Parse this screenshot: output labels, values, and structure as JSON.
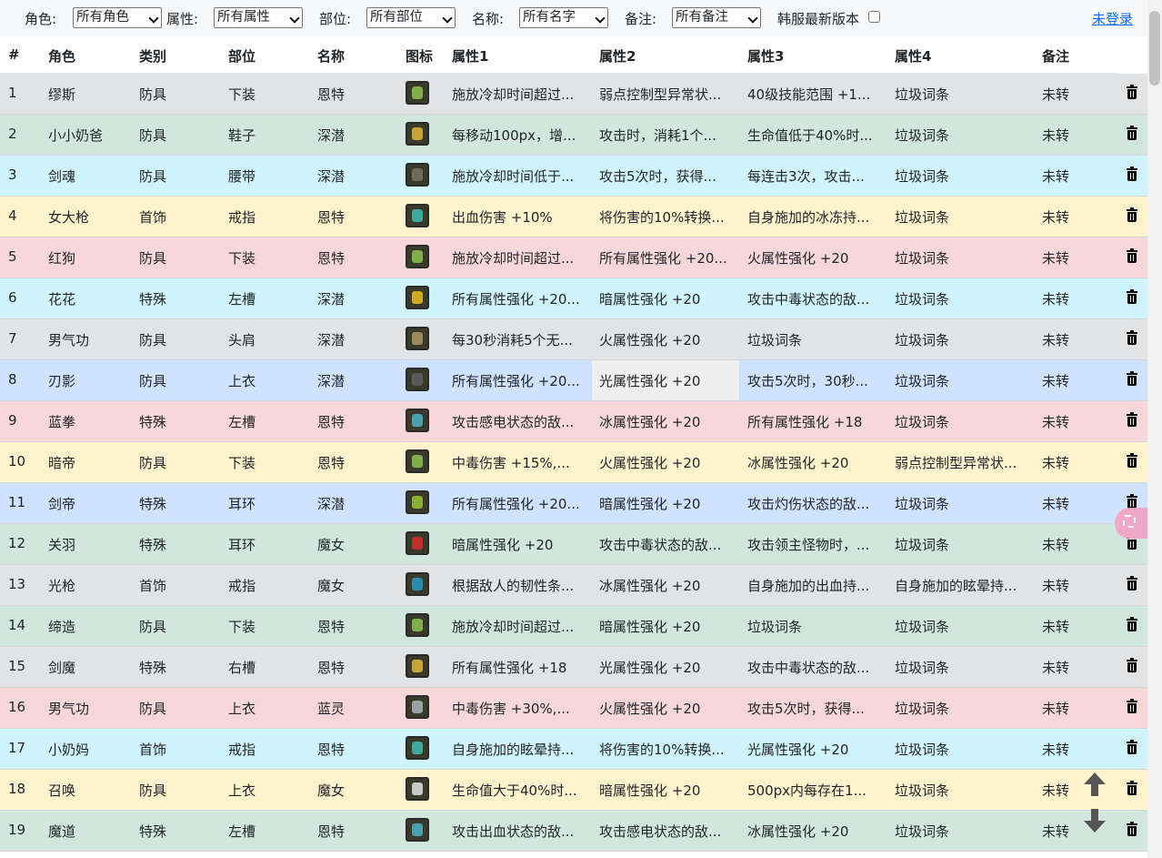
{
  "filters": {
    "role_label": "角色:",
    "role_value": "所有角色",
    "attr_label": "属性:",
    "attr_value": "所有属性",
    "part_label": "部位:",
    "part_value": "所有部位",
    "name_label": "名称:",
    "name_value": "所有名字",
    "note_label": "备注:",
    "note_value": "所有备注",
    "korea_label": "韩服最新版本",
    "login_label": "未登录"
  },
  "table": {
    "headers": [
      "#",
      "角色",
      "类别",
      "部位",
      "名称",
      "图标",
      "属性1",
      "属性2",
      "属性3",
      "属性4",
      "备注"
    ],
    "rows": [
      {
        "n": "1",
        "role": "缪斯",
        "cat": "防具",
        "part": "下装",
        "name": "恩特",
        "a1": "施放冷却时间超过...",
        "a2": "弱点控制型异常状...",
        "a3": "40级技能范围 +1...",
        "a4": "垃圾词条",
        "note": "未转",
        "bg": "#e2e3e5",
        "icon": "#7fae4a"
      },
      {
        "n": "2",
        "role": "小小奶爸",
        "cat": "防具",
        "part": "鞋子",
        "name": "深潜",
        "a1": "每移动100px，增...",
        "a2": "攻击时，消耗1个...",
        "a3": "生命值低于40%时...",
        "a4": "垃圾词条",
        "note": "未转",
        "bg": "#d1e7dd",
        "icon": "#c9a33a"
      },
      {
        "n": "3",
        "role": "剑魂",
        "cat": "防具",
        "part": "腰带",
        "name": "深潜",
        "a1": "施放冷却时间低于...",
        "a2": "攻击5次时，获得...",
        "a3": "每连击3次，攻击...",
        "a4": "垃圾词条",
        "note": "未转",
        "bg": "#cff4fc",
        "icon": "#6e6a60"
      },
      {
        "n": "4",
        "role": "女大枪",
        "cat": "首饰",
        "part": "戒指",
        "name": "恩特",
        "a1": "出血伤害 +10%",
        "a2": "将伤害的10%转换...",
        "a3": "自身施加的冰冻持...",
        "a4": "垃圾词条",
        "note": "未转",
        "bg": "#fff3cd",
        "icon": "#3fa6a0"
      },
      {
        "n": "5",
        "role": "红狗",
        "cat": "防具",
        "part": "下装",
        "name": "恩特",
        "a1": "施放冷却时间超过...",
        "a2": "所有属性强化 +20...",
        "a3": "火属性强化 +20",
        "a4": "垃圾词条",
        "note": "未转",
        "bg": "#f8d7da",
        "icon": "#7fae4a"
      },
      {
        "n": "6",
        "role": "花花",
        "cat": "特殊",
        "part": "左槽",
        "name": "深潜",
        "a1": "所有属性强化 +20...",
        "a2": "暗属性强化 +20",
        "a3": "攻击中毒状态的敌...",
        "a4": "垃圾词条",
        "note": "未转",
        "bg": "#cff4fc",
        "icon": "#d4a81e"
      },
      {
        "n": "7",
        "role": "男气功",
        "cat": "防具",
        "part": "头肩",
        "name": "深潜",
        "a1": "每30秒消耗5个无...",
        "a2": "火属性强化 +20",
        "a3": "垃圾词条",
        "a4": "垃圾词条",
        "note": "未转",
        "bg": "#e2e3e5",
        "icon": "#9a8a5a"
      },
      {
        "n": "8",
        "role": "刃影",
        "cat": "防具",
        "part": "上衣",
        "name": "深潜",
        "a1": "所有属性强化 +20...",
        "a2": "光属性强化 +20",
        "a3": "攻击5次时，30秒...",
        "a4": "垃圾词条",
        "note": "未转",
        "bg": "#cfe2ff",
        "icon": "#5a5a5a",
        "hl": true
      },
      {
        "n": "9",
        "role": "蓝拳",
        "cat": "特殊",
        "part": "左槽",
        "name": "恩特",
        "a1": "攻击感电状态的敌...",
        "a2": "冰属性强化 +20",
        "a3": "所有属性强化 +18",
        "a4": "垃圾词条",
        "note": "未转",
        "bg": "#f8d7da",
        "icon": "#4aa0b0"
      },
      {
        "n": "10",
        "role": "暗帝",
        "cat": "防具",
        "part": "下装",
        "name": "恩特",
        "a1": "中毒伤害 +15%,...",
        "a2": "火属性强化 +20",
        "a3": "冰属性强化 +20",
        "a4": "弱点控制型异常状...",
        "note": "未转",
        "bg": "#fff3cd",
        "icon": "#7fae4a"
      },
      {
        "n": "11",
        "role": "剑帝",
        "cat": "特殊",
        "part": "耳环",
        "name": "深潜",
        "a1": "所有属性强化 +20...",
        "a2": "暗属性强化 +20",
        "a3": "攻击灼伤状态的敌...",
        "a4": "垃圾词条",
        "note": "未转",
        "bg": "#cfe2ff",
        "icon": "#8ab030"
      },
      {
        "n": "12",
        "role": "关羽",
        "cat": "特殊",
        "part": "耳环",
        "name": "魔女",
        "a1": "暗属性强化 +20",
        "a2": "攻击中毒状态的敌...",
        "a3": "攻击领主怪物时，...",
        "a4": "垃圾词条",
        "note": "未转",
        "bg": "#d1e7dd",
        "icon": "#c0302a"
      },
      {
        "n": "13",
        "role": "光枪",
        "cat": "首饰",
        "part": "戒指",
        "name": "魔女",
        "a1": "根据敌人的韧性条...",
        "a2": "冰属性强化 +20",
        "a3": "自身施加的出血持...",
        "a4": "自身施加的眩晕持...",
        "note": "未转",
        "bg": "#e2e3e5",
        "icon": "#2a8ab0"
      },
      {
        "n": "14",
        "role": "缔造",
        "cat": "防具",
        "part": "下装",
        "name": "恩特",
        "a1": "施放冷却时间超过...",
        "a2": "暗属性强化 +20",
        "a3": "垃圾词条",
        "a4": "垃圾词条",
        "note": "未转",
        "bg": "#d1e7dd",
        "icon": "#7fae4a"
      },
      {
        "n": "15",
        "role": "剑魔",
        "cat": "特殊",
        "part": "右槽",
        "name": "恩特",
        "a1": "所有属性强化 +18",
        "a2": "光属性强化 +20",
        "a3": "攻击中毒状态的敌...",
        "a4": "垃圾词条",
        "note": "未转",
        "bg": "#e2e3e5",
        "icon": "#c9a33a"
      },
      {
        "n": "16",
        "role": "男气功",
        "cat": "防具",
        "part": "上衣",
        "name": "蓝灵",
        "a1": "中毒伤害 +30%,...",
        "a2": "火属性强化 +20",
        "a3": "攻击5次时，获得...",
        "a4": "垃圾词条",
        "note": "未转",
        "bg": "#f8d7da",
        "icon": "#9aa0a8"
      },
      {
        "n": "17",
        "role": "小奶妈",
        "cat": "首饰",
        "part": "戒指",
        "name": "恩特",
        "a1": "自身施加的眩晕持...",
        "a2": "将伤害的10%转换...",
        "a3": "光属性强化 +20",
        "a4": "垃圾词条",
        "note": "未转",
        "bg": "#cff4fc",
        "icon": "#3fa6a0"
      },
      {
        "n": "18",
        "role": "召唤",
        "cat": "防具",
        "part": "上衣",
        "name": "魔女",
        "a1": "生命值大于40%时...",
        "a2": "暗属性强化 +20",
        "a3": "500px内每存在1...",
        "a4": "垃圾词条",
        "note": "未转",
        "bg": "#fff3cd",
        "icon": "#c8c8c8"
      },
      {
        "n": "19",
        "role": "魔道",
        "cat": "特殊",
        "part": "左槽",
        "name": "恩特",
        "a1": "攻击出血状态的敌...",
        "a2": "攻击感电状态的敌...",
        "a3": "冰属性强化 +20",
        "a4": "垃圾词条",
        "note": "未转",
        "bg": "#d1e7dd",
        "icon": "#4aa0b0"
      }
    ]
  },
  "icons": {
    "delete": "trash-icon",
    "scroll_up": "arrow-up-icon",
    "scroll_down": "arrow-down-icon",
    "floating": "scan-badge-icon"
  }
}
